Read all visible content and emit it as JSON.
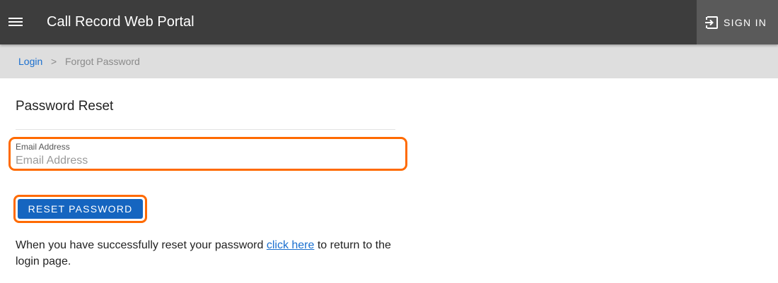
{
  "header": {
    "app_title": "Call Record Web Portal",
    "menu_icon": "hamburger-menu-icon",
    "signin_icon": "sign-in-icon",
    "signin_label": "SIGN IN"
  },
  "breadcrumb": {
    "login": "Login",
    "separator": ">",
    "current": "Forgot Password"
  },
  "form": {
    "title": "Password Reset",
    "email": {
      "label": "Email Address",
      "placeholder": "Email Address",
      "value": ""
    },
    "reset_button": "RESET PASSWORD"
  },
  "info": {
    "before_link": "When you have successfully reset your password ",
    "link_text": "click here",
    "after_link": " to return to the login page."
  },
  "colors": {
    "topbar": "#3d3d3d",
    "signin_bg": "#5a5a5a",
    "breadcrumb_bg": "#dedede",
    "link": "#1a6fcf",
    "primary_button": "#1565c0",
    "highlight": "#ff6a00"
  }
}
